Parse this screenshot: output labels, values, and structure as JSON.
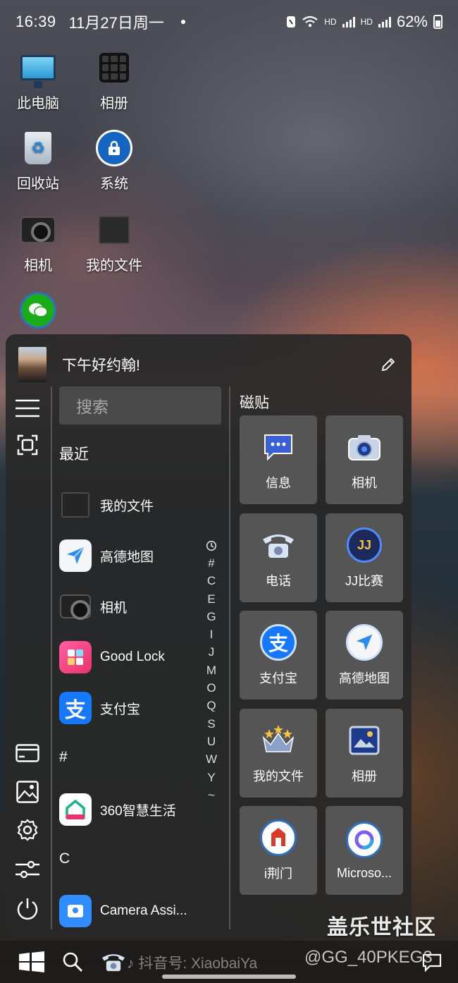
{
  "status_bar": {
    "time": "16:39",
    "date": "11月27日周一",
    "network_1": "HD",
    "network_2": "HD",
    "battery": "62%"
  },
  "desktop_icons": [
    {
      "label": "此电脑",
      "icon": "computer-icon"
    },
    {
      "label": "相册",
      "icon": "gallery-icon"
    },
    {
      "label": "回收站",
      "icon": "recycle-bin-icon"
    },
    {
      "label": "系统",
      "icon": "system-lock-icon"
    },
    {
      "label": "相机",
      "icon": "camera-icon"
    },
    {
      "label": "我的文件",
      "icon": "my-files-icon"
    },
    {
      "label": "",
      "icon": "wechat-icon"
    }
  ],
  "start_menu": {
    "greeting": "下午好约翰!",
    "search_placeholder": "搜索",
    "recent_title": "最近",
    "apps": [
      {
        "name": "我的文件",
        "icon": "my-files-icon"
      },
      {
        "name": "高德地图",
        "icon": "amap-icon"
      },
      {
        "name": "相机",
        "icon": "camera-icon"
      },
      {
        "name": "Good Lock",
        "icon": "good-lock-icon"
      },
      {
        "name": "支付宝",
        "icon": "alipay-icon"
      }
    ],
    "section_hash": "#",
    "hash_apps": [
      {
        "name": "360智慧生活",
        "icon": "smart-life-icon"
      }
    ],
    "section_c": "C",
    "c_apps": [
      {
        "name": "Camera Assi...",
        "icon": "camera-assistant-icon"
      }
    ],
    "alpha_index": [
      "#",
      "C",
      "E",
      "G",
      "I",
      "J",
      "M",
      "O",
      "Q",
      "S",
      "U",
      "W",
      "Y",
      "~"
    ],
    "tiles_title": "磁贴",
    "tiles": [
      {
        "name": "信息",
        "icon": "messages-icon"
      },
      {
        "name": "相机",
        "icon": "camera-icon"
      },
      {
        "name": "电话",
        "icon": "phone-icon"
      },
      {
        "name": "JJ比赛",
        "icon": "jj-icon"
      },
      {
        "name": "支付宝",
        "icon": "alipay-icon"
      },
      {
        "name": "高德地图",
        "icon": "amap-icon"
      },
      {
        "name": "我的文件",
        "icon": "crown-files-icon"
      },
      {
        "name": "相册",
        "icon": "gallery-icon"
      },
      {
        "name": "i荆门",
        "icon": "ijingmen-icon"
      },
      {
        "name": "Microso...",
        "icon": "microsoft-icon"
      }
    ]
  },
  "taskbar": {
    "watermark_left": "抖音号:",
    "watermark_id": "XiaobaiYa",
    "watermark_right": "@GG_40PKEG3",
    "community": "盖乐世社区"
  },
  "colors": {
    "panel_bg": "#282828",
    "tile_bg": "#555555",
    "alipay_blue": "#1677ff",
    "amap_blue": "#2b8cf0"
  }
}
